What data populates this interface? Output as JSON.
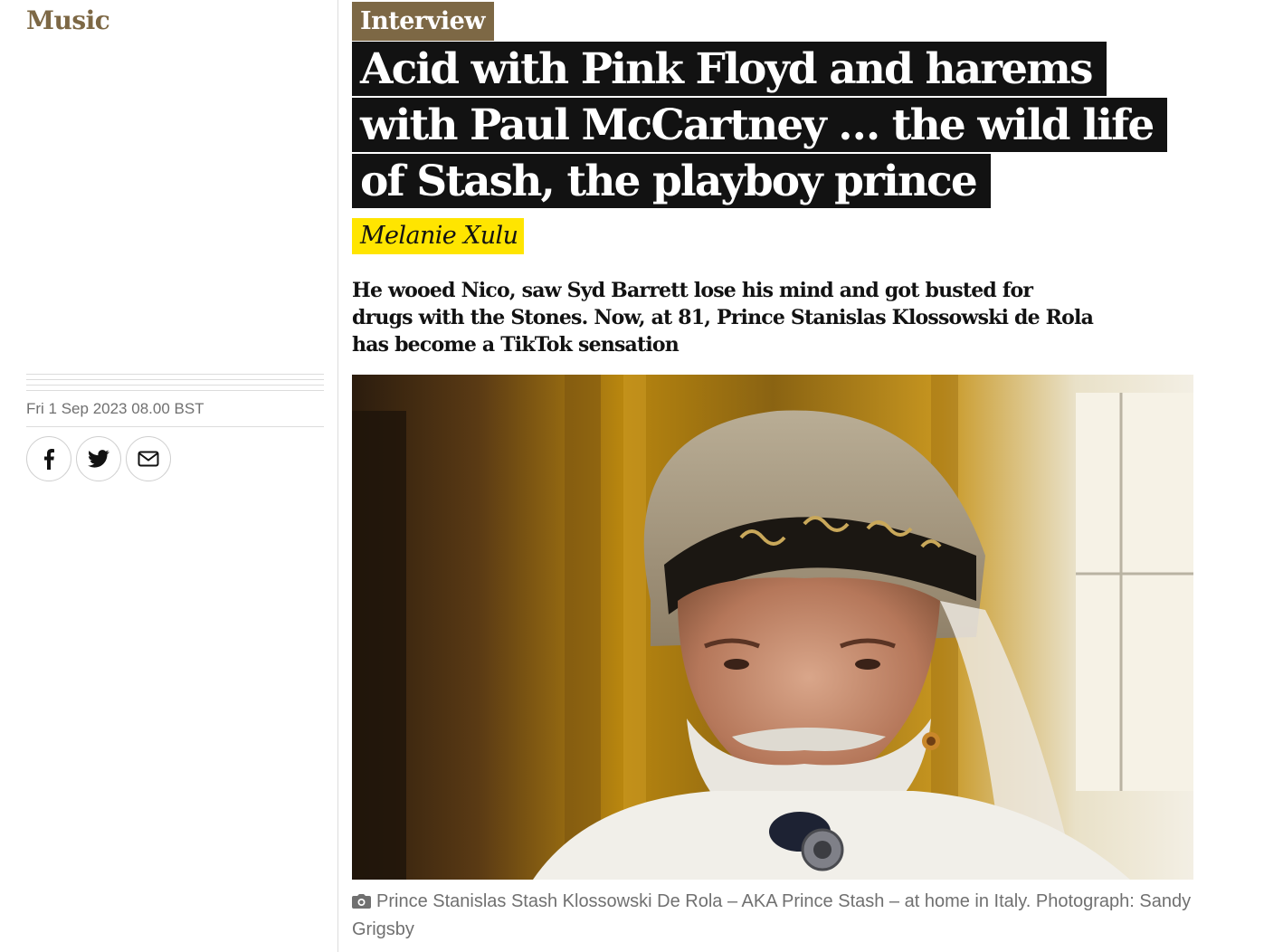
{
  "section": {
    "label": "Music"
  },
  "article": {
    "kicker": "Interview",
    "headline": "Acid with Pink Floyd and harems with Paul McCartney … the wild life of Stash, the playboy prince",
    "byline": "Melanie Xulu",
    "standfirst": "He wooed Nico, saw Syd Barrett lose his mind and got busted for drugs with the Stones. Now, at 81, Prince Stanislas Klossowski de Rola has become a TikTok sensation",
    "dateline": "Fri 1 Sep 2023 08.00 BST",
    "caption": "Prince Stanislas Stash Klossowski De Rola – AKA Prince Stash – at home in Italy. Photograph: Sandy Grigsby"
  },
  "share": {
    "buttons": [
      {
        "icon": "facebook-icon"
      },
      {
        "icon": "twitter-icon"
      },
      {
        "icon": "email-icon"
      }
    ]
  },
  "media": {
    "photo_icon": "camera-icon"
  },
  "colors": {
    "section_accent": "#7d6845",
    "headline_background": "#121212",
    "byline_highlight": "#ffe500",
    "meta_text": "#707070"
  }
}
